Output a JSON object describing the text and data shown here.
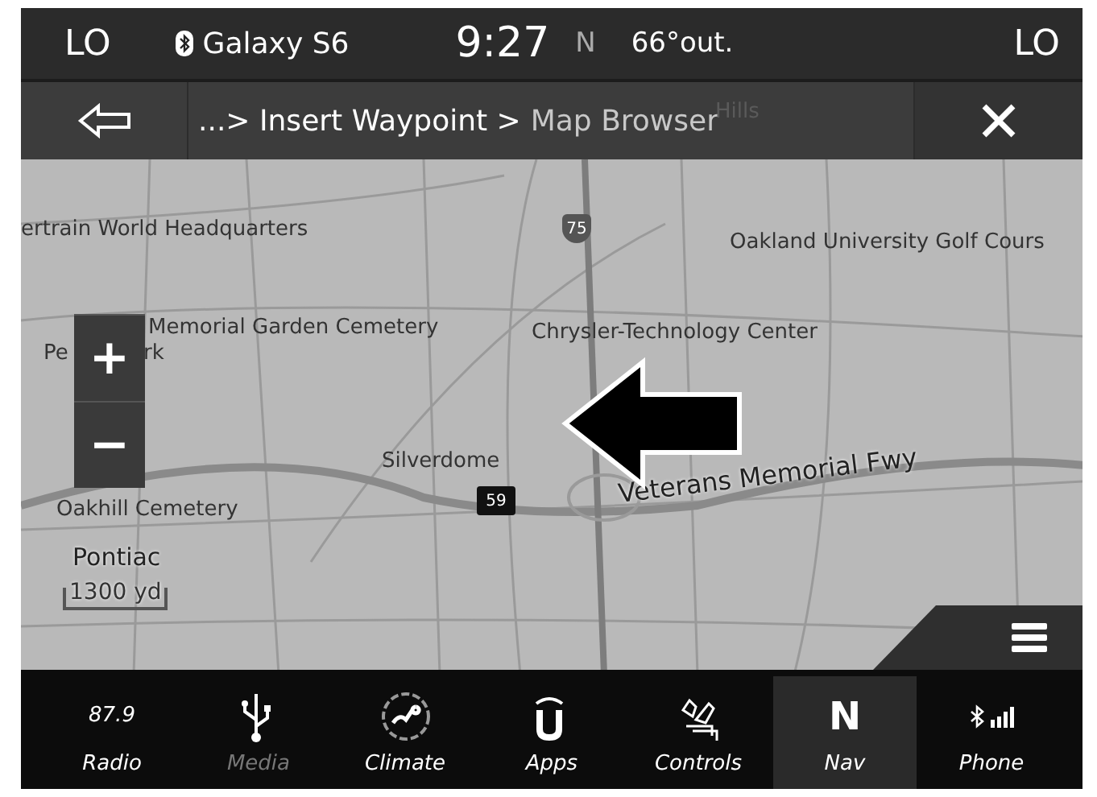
{
  "status_bar": {
    "left_temp": "LO",
    "device": "Galaxy S6",
    "time": "9:27",
    "heading": "N",
    "outside_temp": "66°out.",
    "right_temp": "LO"
  },
  "nav_bar": {
    "breadcrumb_prefix": "...> Insert Waypoint >",
    "breadcrumb_current": "Map Browser",
    "faded_label": "Hills"
  },
  "map": {
    "labels": [
      {
        "text": "ertrain World Headquarters",
        "kind": "place"
      },
      {
        "text": "Oakland University Golf Cours",
        "kind": "place"
      },
      {
        "text": "Memorial Garden Cemetery",
        "kind": "place"
      },
      {
        "text": "Pe",
        "kind": "place"
      },
      {
        "text": "rk",
        "kind": "place"
      },
      {
        "text": "Chrysler-Technology Center",
        "kind": "place"
      },
      {
        "text": "Silverdome",
        "kind": "place"
      },
      {
        "text": "Oakhill Cemetery",
        "kind": "place"
      },
      {
        "text": "Pontiac",
        "kind": "city"
      },
      {
        "text": "Veterans Memorial Fwy",
        "kind": "road"
      }
    ],
    "shields": [
      {
        "text": "75",
        "kind": "interstate"
      },
      {
        "text": "59",
        "kind": "state"
      }
    ],
    "zoom_in": "+",
    "zoom_out": "−",
    "scale": "1300 yd"
  },
  "bottom_bar": [
    {
      "label": "Radio",
      "kind": "radio",
      "reading": "87.9",
      "selected": false,
      "disabled": false
    },
    {
      "label": "Media",
      "kind": "usb",
      "selected": false,
      "disabled": true
    },
    {
      "label": "Climate",
      "kind": "climate",
      "selected": false,
      "disabled": false
    },
    {
      "label": "Apps",
      "kind": "apps",
      "selected": false,
      "disabled": false
    },
    {
      "label": "Controls",
      "kind": "controls",
      "selected": false,
      "disabled": false
    },
    {
      "label": "Nav",
      "kind": "nav",
      "reading": "N",
      "selected": true,
      "disabled": false
    },
    {
      "label": "Phone",
      "kind": "phone",
      "selected": false,
      "disabled": false
    }
  ]
}
